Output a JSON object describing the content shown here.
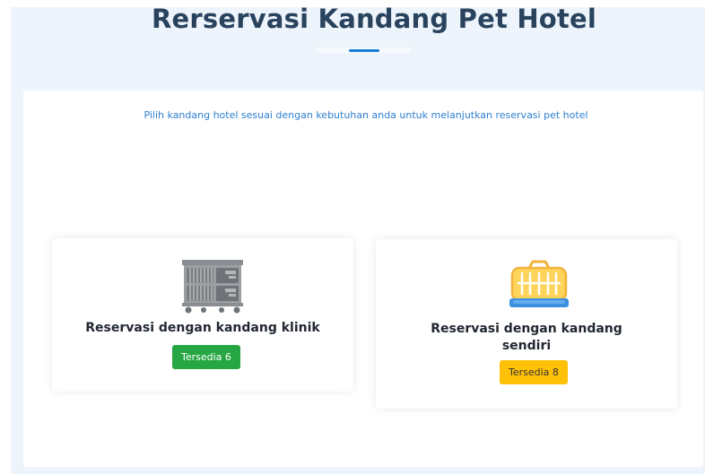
{
  "page": {
    "title": "Rerservasi Kandang Pet Hotel",
    "subtitle": "Pilih kandang hotel sesuai dengan kebutuhan anda untuk melanjutkan reservasi pet hotel"
  },
  "options": [
    {
      "title": "Reservasi dengan kandang klinik",
      "badge": "Tersedia 6",
      "icon": "clinic-cage-icon",
      "badge_color": "#27a744"
    },
    {
      "title": "Reservasi dengan kandang sendiri",
      "badge": "Tersedia 8",
      "icon": "pet-carrier-icon",
      "badge_color": "#ffc107"
    }
  ],
  "colors": {
    "title": "#29435e",
    "accent": "#1a7fd8",
    "subtitle": "#2f7fd0",
    "background": "#eef4fb"
  }
}
